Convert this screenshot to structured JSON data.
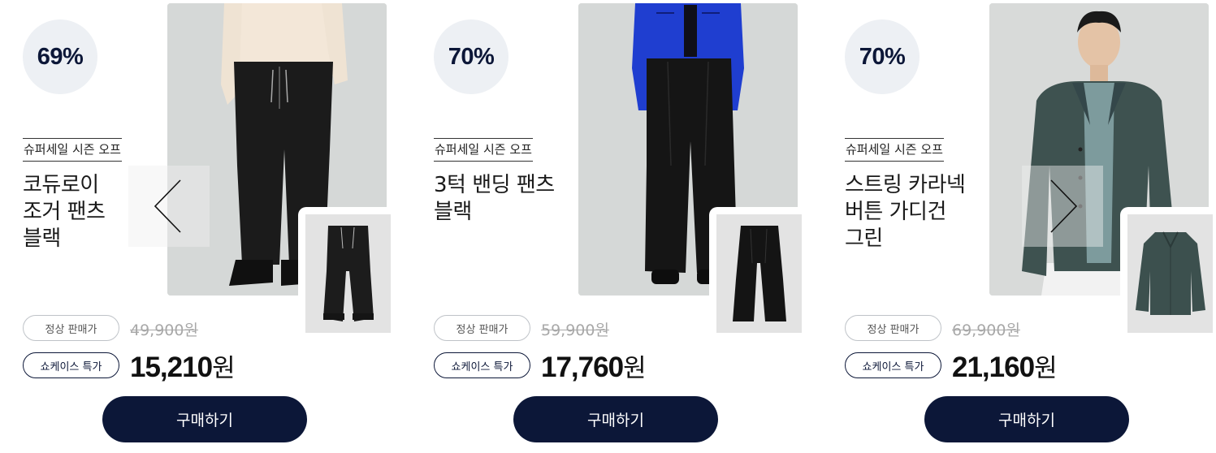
{
  "carousel": {
    "prev_icon": "chevron-left-icon",
    "next_icon": "chevron-right-icon"
  },
  "products": [
    {
      "discount": "69%",
      "tag": "슈퍼세일 시즌 오프",
      "name": "코듀로이\n조거 팬츠\n블랙",
      "regular_label": "정상 판매가",
      "original_price": "49,900원",
      "special_label": "쇼케이스 특가",
      "sale_price_number": "15,210",
      "currency": "원",
      "buy_label": "구매하기"
    },
    {
      "discount": "70%",
      "tag": "슈퍼세일 시즌 오프",
      "name": "3턱 밴딩 팬츠\n블랙",
      "regular_label": "정상 판매가",
      "original_price": "59,900원",
      "special_label": "쇼케이스 특가",
      "sale_price_number": "17,760",
      "currency": "원",
      "buy_label": "구매하기"
    },
    {
      "discount": "70%",
      "tag": "슈퍼세일 시즌 오프",
      "name": "스트링 카라넥\n버튼 가디건\n그린",
      "regular_label": "정상 판매가",
      "original_price": "69,900원",
      "special_label": "쇼케이스 특가",
      "sale_price_number": "21,160",
      "currency": "원",
      "buy_label": "구매하기"
    }
  ],
  "colors": {
    "navy": "#0c1738",
    "badge_bg": "#edf0f4",
    "strike_gray": "#a8a8a8"
  }
}
